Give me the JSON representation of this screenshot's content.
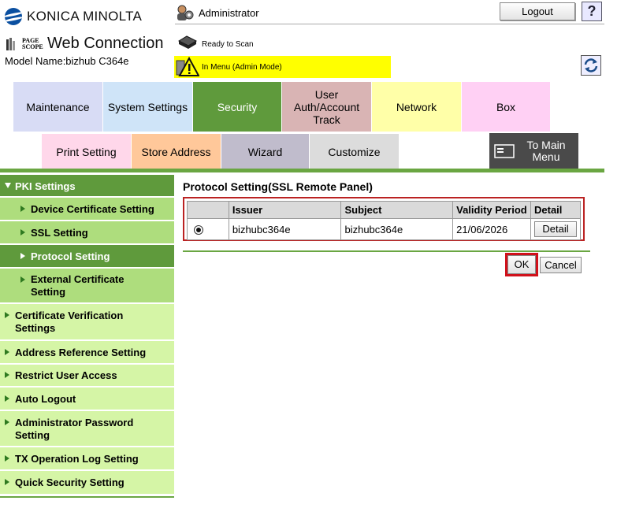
{
  "brand": {
    "logo_text": "KONICA MINOLTA",
    "pagescope_small": "PAGE SCOPE",
    "product_title": "Web Connection",
    "model_name": "Model Name:bizhub C364e"
  },
  "header": {
    "user_label": "Administrator",
    "logout_label": "Logout",
    "help_label": "?",
    "scan_status": "Ready to Scan",
    "mode_status": "In Menu (Admin Mode)",
    "mode_color": "#ffff00"
  },
  "tabs": {
    "primary": [
      {
        "label": "Maintenance"
      },
      {
        "label": "System Settings"
      },
      {
        "label": "Security",
        "active": true
      },
      {
        "label": "User Auth/Account Track"
      },
      {
        "label": "Network"
      },
      {
        "label": "Box"
      }
    ],
    "secondary": [
      {
        "label": "Print Setting"
      },
      {
        "label": "Store Address"
      },
      {
        "label": "Wizard"
      },
      {
        "label": "Customize"
      }
    ],
    "to_main_menu": "To Main Menu"
  },
  "sidebar": {
    "header": "PKI Settings",
    "sub_items": [
      {
        "label": "Device Certificate Setting"
      },
      {
        "label": "SSL Setting"
      },
      {
        "label": "Protocol Setting",
        "active": true
      },
      {
        "label": "External Certificate Setting"
      }
    ],
    "items": [
      {
        "label": "Certificate Verification Settings"
      },
      {
        "label": "Address Reference Setting"
      },
      {
        "label": "Restrict User Access"
      },
      {
        "label": "Auto Logout"
      },
      {
        "label": "Administrator Password Setting"
      },
      {
        "label": "TX Operation Log Setting"
      },
      {
        "label": "Quick Security Setting"
      }
    ]
  },
  "main": {
    "title": "Protocol Setting(SSL Remote Panel)",
    "table": {
      "columns": [
        "",
        "Issuer",
        "Subject",
        "Validity Period",
        "Detail"
      ],
      "rows": [
        {
          "selected": true,
          "issuer": "bizhubc364e",
          "subject": "bizhubc364e",
          "validity": "21/06/2026",
          "detail_label": "Detail"
        }
      ]
    },
    "ok_label": "OK",
    "cancel_label": "Cancel"
  },
  "colors": {
    "security_green": "#5f9a3c",
    "highlight_red": "#d0101a"
  }
}
